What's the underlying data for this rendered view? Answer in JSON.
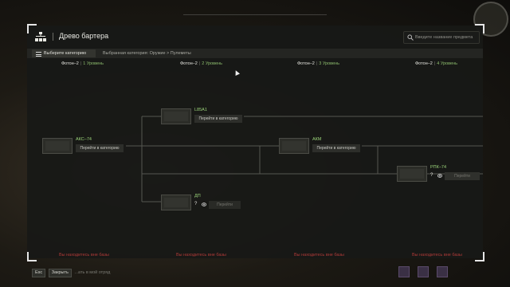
{
  "window": {
    "title": "Древо бартера"
  },
  "search": {
    "placeholder": "Введите название предмета"
  },
  "subbar": {
    "category_button": "Выберите категорию",
    "breadcrumb": "Выбранная категория: Оружие > Пулеметы"
  },
  "columns": [
    {
      "name": "Фотон–2",
      "level": "1 Уровень"
    },
    {
      "name": "Фотон–2",
      "level": "2 Уровень"
    },
    {
      "name": "Фотон–2",
      "level": "3 Уровень"
    },
    {
      "name": "Фотон–2",
      "level": "4 Уровень"
    }
  ],
  "column_footer": "Вы находитесь вне базы",
  "nodes": {
    "aks74": {
      "name": "АКС–74",
      "action": "Перейти в категорию"
    },
    "l85a1": {
      "name": "L85A1",
      "action": "Перейти в категорию"
    },
    "akm": {
      "name": "АКМ",
      "action": "Перейти в категорию"
    },
    "dp": {
      "name": "ДП",
      "question": "?",
      "action": "Перейти"
    },
    "rpk74": {
      "name": "РПК–74",
      "question": "?",
      "action": "Перейти"
    }
  },
  "bottom_bar": {
    "esc_key": "Esc",
    "close_label": "Закрыть",
    "hint_text": "...ать в мой отряд"
  },
  "colors": {
    "accent_green": "#9bd37a",
    "level_green": "#8fbf6f",
    "warning_red": "#b03a38",
    "panel_bg": "#171816"
  },
  "icons": {
    "logo": "barter-tree-logo-icon",
    "search": "search-icon",
    "menu": "hamburger-icon",
    "eye": "eye-icon"
  }
}
